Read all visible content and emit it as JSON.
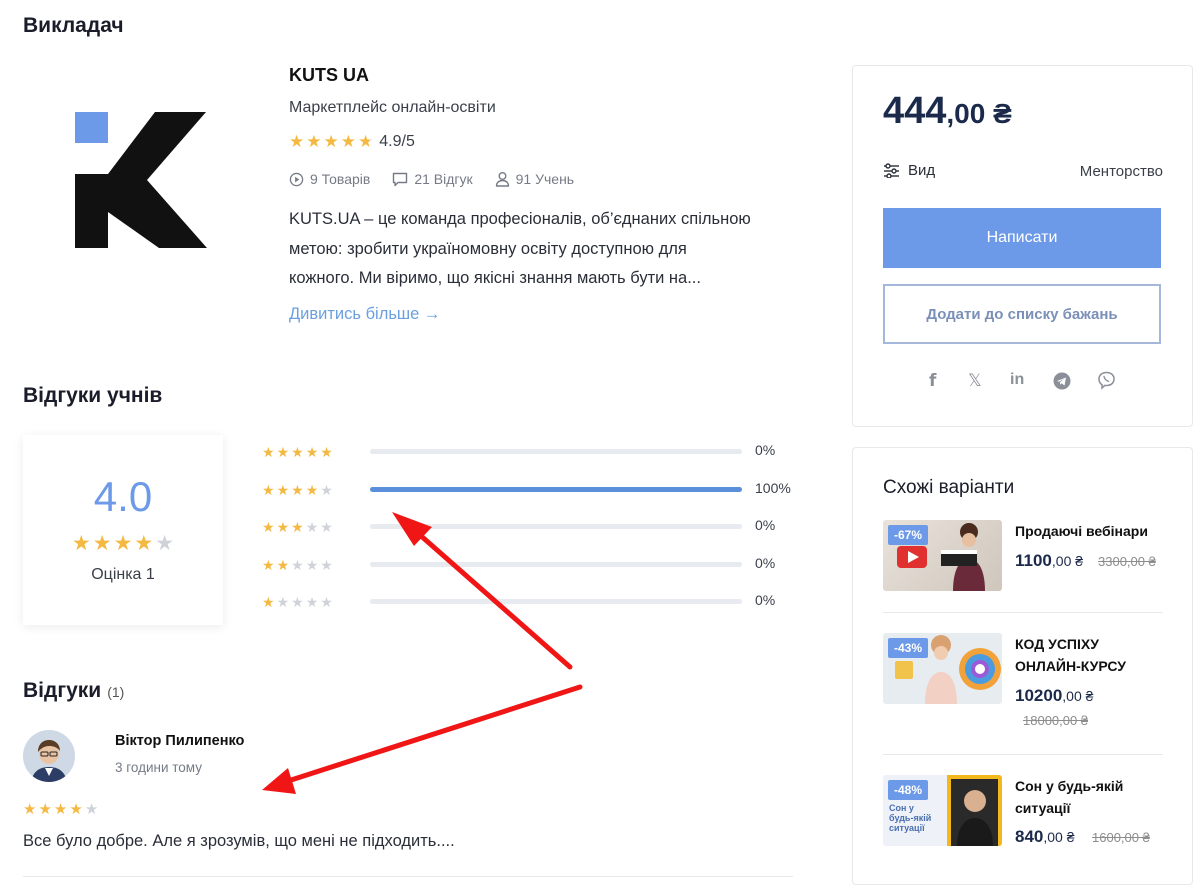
{
  "instructor_section": {
    "heading": "Викладач",
    "name": "KUTS UA",
    "subtitle": "Маркетплейс онлайн-освіти",
    "rating_value": "4.9/5",
    "rating_stars": 4.9,
    "stats": {
      "products": "9 Товарів",
      "reviews": "21 Відгук",
      "students": "91 Учень"
    },
    "bio_lines": [
      "KUTS.UA – це команда професіоналів, об’єднаних спільною",
      "метою: зробити україномовну освіту доступною для",
      "кожного. Ми віримо, що якісні знання мають бути на..."
    ],
    "see_more": "Дивитись більше →",
    "logo_colors": {
      "square": "#6c9ae8",
      "letter": "#111111"
    }
  },
  "student_reviews": {
    "heading": "Відгуки учнів",
    "average": "4.0",
    "average_stars": 4,
    "rating_label": "Оцінка 1",
    "distribution": [
      {
        "stars": 5,
        "percent": 0,
        "label": "0%"
      },
      {
        "stars": 4,
        "percent": 100,
        "label": "100%"
      },
      {
        "stars": 3,
        "percent": 0,
        "label": "0%"
      },
      {
        "stars": 2,
        "percent": 0,
        "label": "0%"
      },
      {
        "stars": 1,
        "percent": 0,
        "label": "0%"
      }
    ]
  },
  "reviews": {
    "heading": "Відгуки",
    "count": "(1)",
    "items": [
      {
        "author": "Віктор Пилипенко",
        "time": "3 години тому",
        "stars": 4,
        "text": "Все було добре. Але я зрозумів, що мені не підходить...."
      }
    ]
  },
  "purchase_card": {
    "price_main": "444",
    "price_cents": ",00 ₴",
    "type_label": "Вид",
    "type_value": "Менторство",
    "write_button": "Написати",
    "wishlist_button": "Додати до списку бажань",
    "social_icons": [
      "facebook-icon",
      "x-icon",
      "linkedin-icon",
      "telegram-icon",
      "viber-icon"
    ]
  },
  "similar": {
    "heading": "Схожі варіанти",
    "items": [
      {
        "badge": "-67%",
        "title_lines": [
          "Продаючі вебінари"
        ],
        "price": "1100",
        "cents": ",00 ₴",
        "old_price": "3300,00 ₴"
      },
      {
        "badge": "-43%",
        "title_lines": [
          "КОД УСПІХУ",
          "ОНЛАЙН-КУРСУ"
        ],
        "price": "10200",
        "cents": ",00 ₴",
        "old_price": "18000,00 ₴"
      },
      {
        "badge": "-48%",
        "title_lines": [
          "Сон у будь-якій",
          "ситуації"
        ],
        "price": "840",
        "cents": ",00 ₴",
        "old_price": "1600,00 ₴",
        "thumb_text": [
          "Сон у",
          "будь-якій",
          "ситуації"
        ]
      }
    ]
  },
  "colors": {
    "accent": "#6c9ae8",
    "star": "#f4b942",
    "annotation_arrow": "#f01616"
  }
}
